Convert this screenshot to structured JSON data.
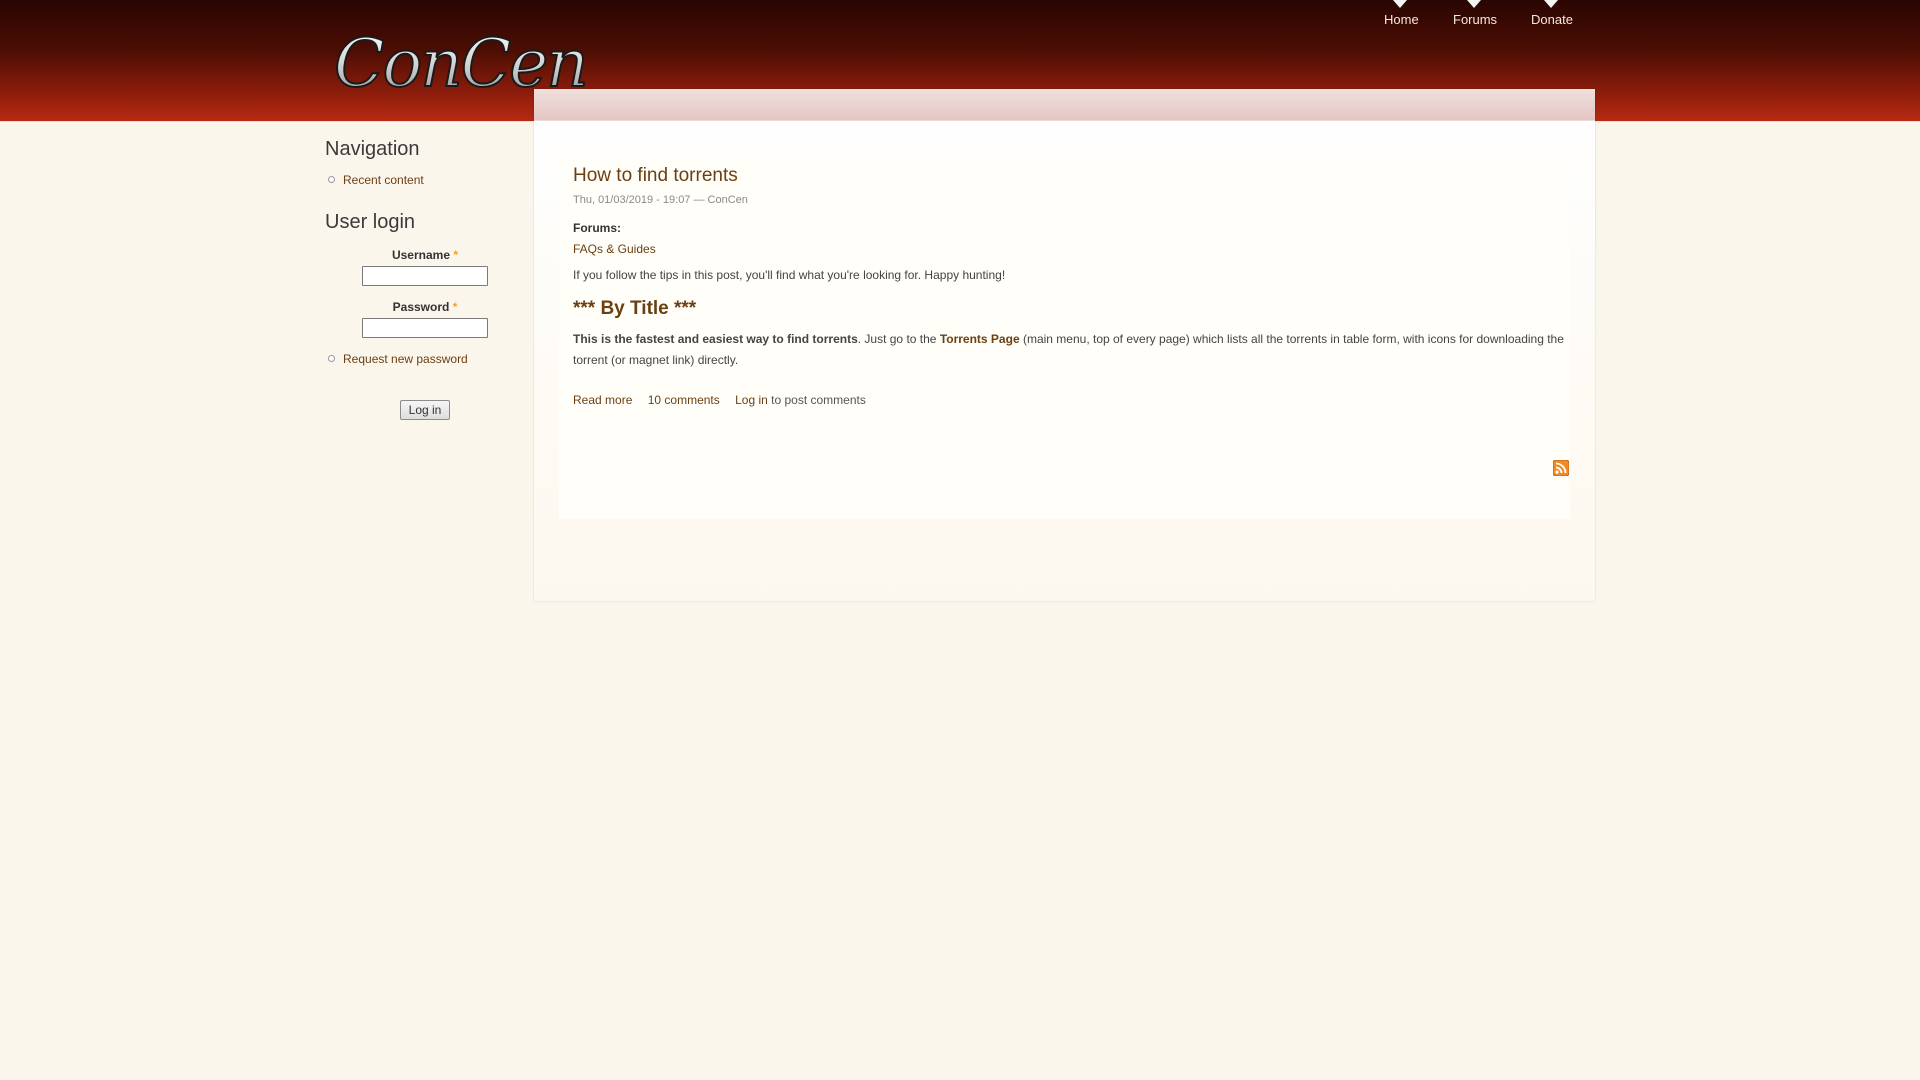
{
  "site": {
    "logo_text": "ConCen"
  },
  "main_menu": [
    {
      "label": "Home"
    },
    {
      "label": "Forums"
    },
    {
      "label": "Donate"
    }
  ],
  "sidebar": {
    "navigation": {
      "title": "Navigation",
      "items": [
        {
          "label": "Recent content"
        }
      ]
    },
    "user_login": {
      "title": "User login",
      "username_label": "Username",
      "password_label": "Password",
      "required_mark": "*",
      "username_value": "",
      "password_value": "",
      "links": [
        {
          "label": "Request new password"
        }
      ],
      "submit_label": "Log in"
    }
  },
  "article": {
    "title": "How to find torrents",
    "meta": "Thu, 01/03/2019 - 19:07 — ConCen",
    "field_label": "Forums:",
    "field_value": "FAQs & Guides",
    "intro": "If you follow the tips in this post, you'll find what you're looking for. Happy hunting!",
    "heading": "*** By Title ***",
    "body_strong": "This is the fastest and easiest way to find torrents",
    "body_mid": ". Just go to the ",
    "body_link": "Torrents Page",
    "body_end": " (main menu, top of every page) which lists all the torrents in table form, with icons for downloading the torrent (or magnet link) directly.",
    "links": {
      "read_more": "Read more",
      "comments": "10 comments",
      "login": "Log in",
      "login_suffix": " to post comments"
    }
  },
  "icons": {
    "rss": "rss-feed-icon",
    "bullet": "circle-bullet-icon"
  },
  "colors": {
    "header_dark": "#2a0602",
    "header_red": "#b62a12",
    "link": "#6b3f12",
    "background": "#fbf6ec"
  }
}
